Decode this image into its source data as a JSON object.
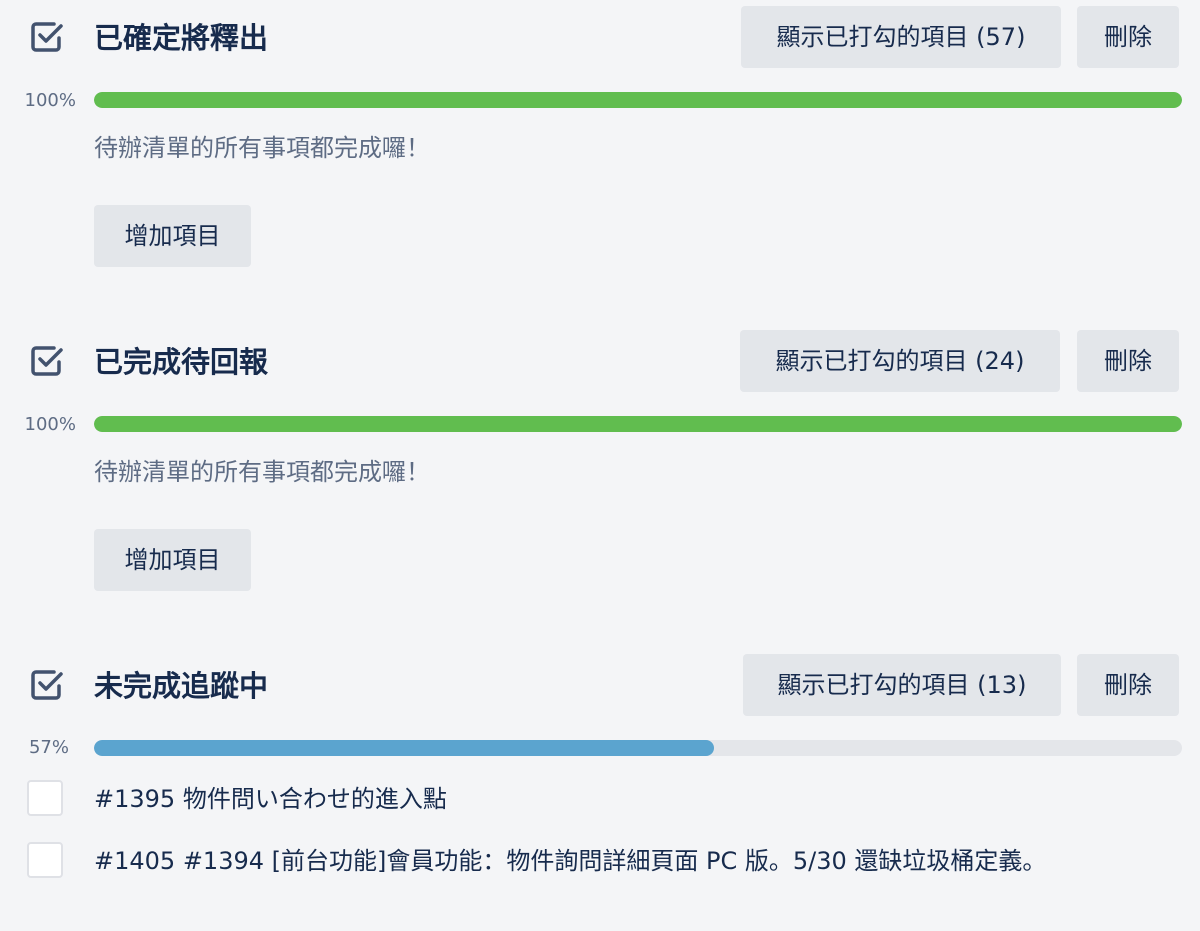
{
  "checklists": [
    {
      "title": "已確定將釋出",
      "show_checked_label": "顯示已打勾的項目 (57)",
      "delete_label": "刪除",
      "percent_label": "100%",
      "progress": 1.0,
      "done_message": "待辦清單的所有事項都完成囉！",
      "add_item_label": "增加項目"
    },
    {
      "title": "已完成待回報",
      "show_checked_label": "顯示已打勾的項目 (24)",
      "delete_label": "刪除",
      "percent_label": "100%",
      "progress": 1.0,
      "done_message": "待辦清單的所有事項都完成囉！",
      "add_item_label": "增加項目"
    },
    {
      "title": "未完成追蹤中",
      "show_checked_label": "顯示已打勾的項目 (13)",
      "delete_label": "刪除",
      "percent_label": "57%",
      "progress": 0.57,
      "items": [
        {
          "text": "#1395 物件問い合わせ的進入點",
          "checked": false
        },
        {
          "text": "#1405 #1394 [前台功能]會員功能：物件詢問詳細頁面 PC 版。5/30 還缺垃圾桶定義。",
          "checked": false
        }
      ]
    }
  ],
  "colors": {
    "complete_bar": "#61bd4f",
    "incomplete_bar": "#5ba4cf",
    "track": "#e4e6ea"
  },
  "icons": {
    "checklist_header": "checkbox-checked-icon"
  }
}
